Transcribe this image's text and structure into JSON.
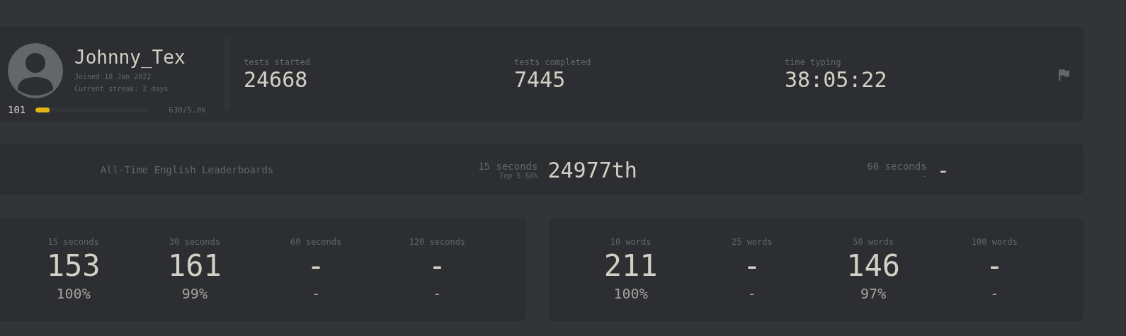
{
  "profile": {
    "name": "Johnny_Tex",
    "joined": "Joined 18 Jan 2022",
    "streak": "Current streak: 2 days",
    "level_number": "101",
    "level": 0.126,
    "xp": "630/5.0k"
  },
  "stats": [
    {
      "label": "tests started",
      "value": "24668"
    },
    {
      "label": "tests completed",
      "value": "7445"
    },
    {
      "label": "time typing",
      "value": "38:05:22"
    }
  ],
  "leaderboards": {
    "title": "All-Time English Leaderboards",
    "entries": [
      {
        "label": "15 seconds",
        "sub": "Top 5.68%",
        "rank": "24977th"
      },
      {
        "label": "60 seconds",
        "sub": "-",
        "rank": "-"
      }
    ]
  },
  "personal_bests": [
    [
      {
        "label": "15 seconds",
        "wpm": "153",
        "acc": "100%"
      },
      {
        "label": "30 seconds",
        "wpm": "161",
        "acc": "99%"
      },
      {
        "label": "60 seconds",
        "wpm": "-",
        "acc": "-"
      },
      {
        "label": "120 seconds",
        "wpm": "-",
        "acc": "-"
      }
    ],
    [
      {
        "label": "10 words",
        "wpm": "211",
        "acc": "100%"
      },
      {
        "label": "25 words",
        "wpm": "-",
        "acc": "-"
      },
      {
        "label": "50 words",
        "wpm": "146",
        "acc": "97%"
      },
      {
        "label": "100 words",
        "wpm": "-",
        "acc": "-"
      }
    ]
  ]
}
